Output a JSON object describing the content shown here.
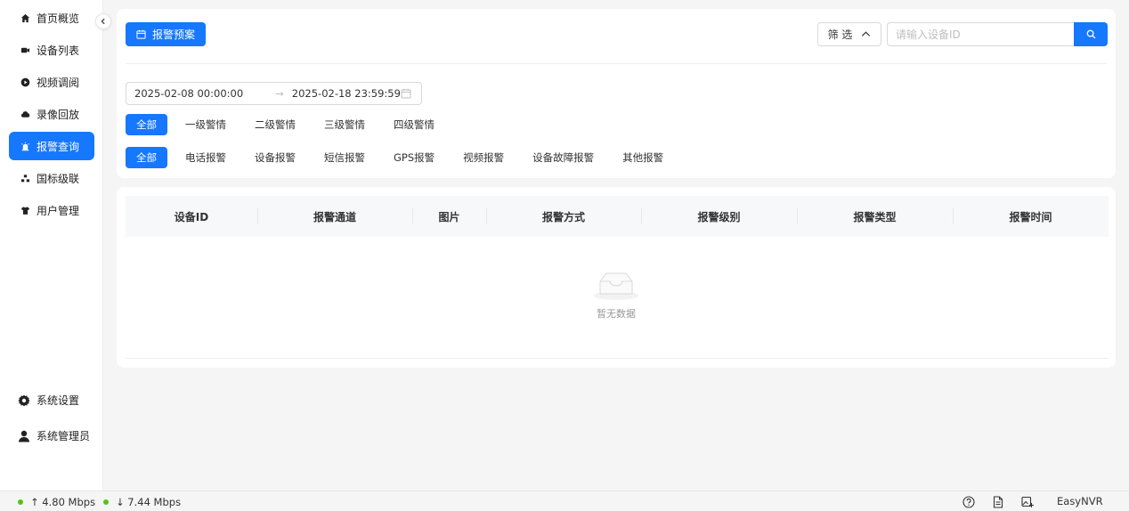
{
  "sidebar": {
    "items": [
      {
        "label": "首页概览",
        "icon": "home-icon"
      },
      {
        "label": "设备列表",
        "icon": "camera-icon"
      },
      {
        "label": "视频调阅",
        "icon": "play-circle-icon"
      },
      {
        "label": "录像回放",
        "icon": "cloud-icon"
      },
      {
        "label": "报警查询",
        "icon": "alarm-icon",
        "active": true
      },
      {
        "label": "国标级联",
        "icon": "cascade-icon"
      },
      {
        "label": "用户管理",
        "icon": "shirt-icon"
      }
    ],
    "bottom": {
      "settings_label": "系统设置",
      "admin_label": "系统管理员"
    }
  },
  "toolbar": {
    "preset_label": "报警预案",
    "filter_label": "筛 选",
    "search_placeholder": "请输入设备ID"
  },
  "date_range": {
    "start": "2025-02-08 00:00:00",
    "separator": "→",
    "end": "2025-02-18 23:59:59"
  },
  "level_filters": [
    "全部",
    "一级警情",
    "二级警情",
    "三级警情",
    "四级警情"
  ],
  "type_filters": [
    "全部",
    "电话报警",
    "设备报警",
    "短信报警",
    "GPS报警",
    "视频报警",
    "设备故障报警",
    "其他报警"
  ],
  "table": {
    "columns": [
      "设备ID",
      "报警通道",
      "图片",
      "报警方式",
      "报警级别",
      "报警类型",
      "报警时间"
    ],
    "rows": [],
    "empty_text": "暂无数据"
  },
  "statusbar": {
    "upload": "↑ 4.80 Mbps",
    "download": "↓ 7.44 Mbps",
    "brand": "EasyNVR"
  },
  "colors": {
    "accent": "#1677ff",
    "status_ok": "#52c41a"
  }
}
